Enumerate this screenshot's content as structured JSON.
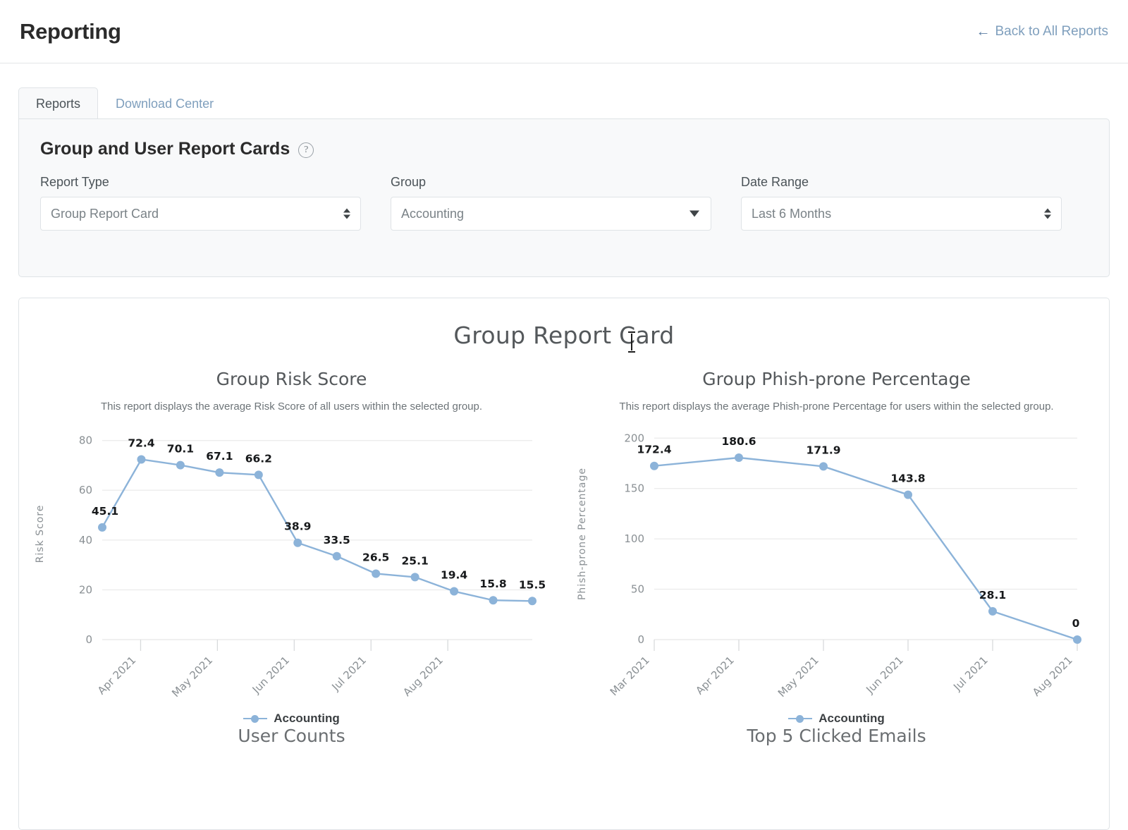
{
  "header": {
    "title": "Reporting",
    "back_link": "Back to All Reports",
    "back_arrow_glyph": "←"
  },
  "tabs": [
    {
      "label": "Reports",
      "active": true
    },
    {
      "label": "Download Center",
      "active": false
    }
  ],
  "filter_card": {
    "title": "Group and User Report Cards",
    "help_icon": "help-circle-icon",
    "help_glyph": "?",
    "fields": [
      {
        "label": "Report Type",
        "value": "Group Report Card",
        "indicator": "updown-arrows-icon"
      },
      {
        "label": "Group",
        "value": "Accounting",
        "indicator": "chevron-down-icon"
      },
      {
        "label": "Date Range",
        "value": "Last 6 Months",
        "indicator": "updown-arrows-icon"
      }
    ]
  },
  "report": {
    "heading": "Group Report Card",
    "bottom_sections": [
      {
        "title": "User Counts"
      },
      {
        "title": "Top 5 Clicked Emails"
      }
    ]
  },
  "colors": {
    "series": "#8cb3d9",
    "link": "#7f9fbd",
    "grid": "#ececec",
    "label_text": "#17191b"
  },
  "chart_data": [
    {
      "type": "line",
      "title": "Group Risk Score",
      "subtitle": "This report displays the average Risk Score of all users within the selected group.",
      "xlabel": "",
      "ylabel": "Risk Score",
      "ylim": [
        0,
        85
      ],
      "yticks": [
        0,
        20,
        40,
        60,
        80
      ],
      "xtick_labels": [
        "Apr 2021",
        "May 2021",
        "Jun 2021",
        "Jul 2021",
        "Aug 2021"
      ],
      "grid": true,
      "legend": "Accounting",
      "legend_position": "bottom",
      "series": [
        {
          "name": "Accounting",
          "values": [
            45.1,
            72.4,
            70.1,
            67.1,
            66.2,
            38.9,
            33.5,
            26.5,
            25.1,
            19.4,
            15.8,
            15.5
          ]
        }
      ],
      "point_labels": [
        "45.1",
        "72.4",
        "70.1",
        "67.1",
        "66.2",
        "38.9",
        "33.5",
        "26.5",
        "25.1",
        "19.4",
        "15.8",
        "15.5"
      ]
    },
    {
      "type": "line",
      "title": "Group Phish-prone Percentage",
      "subtitle": "This report displays the average Phish-prone Percentage for users within the selected group.",
      "xlabel": "",
      "ylabel": "Phish-prone Percentage",
      "ylim": [
        0,
        210
      ],
      "yticks": [
        0,
        50,
        100,
        150,
        200
      ],
      "xtick_labels": [
        "Mar 2021",
        "Apr 2021",
        "May 2021",
        "Jun 2021",
        "Jul 2021",
        "Aug 2021"
      ],
      "grid": true,
      "legend": "Accounting",
      "legend_position": "bottom",
      "series": [
        {
          "name": "Accounting",
          "values": [
            172.4,
            180.6,
            171.9,
            143.8,
            28.1,
            0
          ]
        }
      ],
      "point_labels": [
        "172.4",
        "180.6",
        "171.9",
        "143.8",
        "28.1",
        "0"
      ]
    }
  ]
}
